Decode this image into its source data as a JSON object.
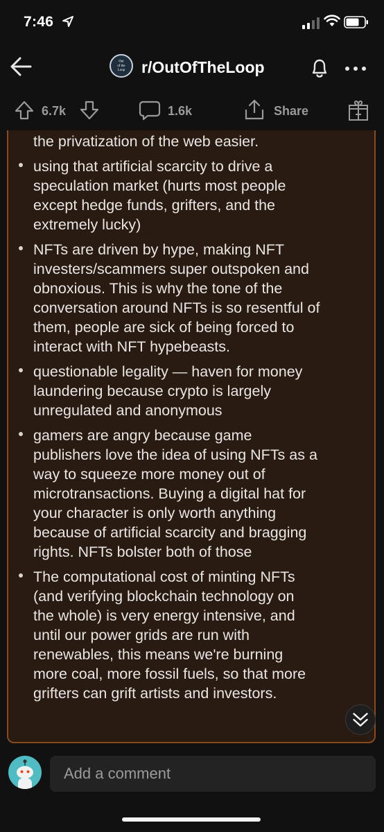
{
  "status_bar": {
    "time": "7:46"
  },
  "header": {
    "subreddit": "r/OutOfTheLoop",
    "avatar_text": [
      "Out",
      "of the",
      "Loop"
    ]
  },
  "actions": {
    "votes": "6.7k",
    "comments": "1.6k",
    "share": "Share"
  },
  "post": {
    "paragraphs": [
      {
        "bullet": false,
        "lines": [
          "the privatization of the web easier."
        ]
      },
      {
        "bullet": true,
        "lines": [
          "using that artificial scarcity to drive a",
          "speculation market (hurts most people",
          "except hedge funds, grifters, and the",
          "extremely lucky)"
        ]
      },
      {
        "bullet": true,
        "lines": [
          "NFTs are driven by hype, making NFT",
          "investers/scammers super outspoken and",
          "obnoxious. This is why the tone of the",
          "conversation around NFTs is so resentful of",
          "them, people are sick of being forced to",
          "interact with NFT hypebeasts."
        ]
      },
      {
        "bullet": true,
        "lines": [
          "questionable legality — haven for money",
          "laundering because crypto is largely",
          "unregulated and anonymous"
        ]
      },
      {
        "bullet": true,
        "lines": [
          "gamers are angry because game",
          "publishers love the idea of using NFTs as a",
          "way to squeeze more money out of",
          "microtransactions. Buying a digital hat for",
          "your character is only worth anything",
          "because of artificial scarcity and bragging",
          "rights. NFTs bolster both of those"
        ]
      },
      {
        "bullet": true,
        "lines": [
          "The computational cost of minting NFTs",
          "(and verifying blockchain technology on",
          "the whole) is very energy intensive, and",
          "until our power grids are run with",
          "renewables, this means we're burning",
          "more coal, more fossil fuels, so that more",
          "grifters can grift artists and investors."
        ]
      }
    ]
  },
  "comment_bar": {
    "placeholder": "Add a comment"
  },
  "colors": {
    "background": "#111111",
    "panel": "#2a1b12",
    "panel_border": "#8a4a1e",
    "avatar": "#4fbcc3"
  }
}
